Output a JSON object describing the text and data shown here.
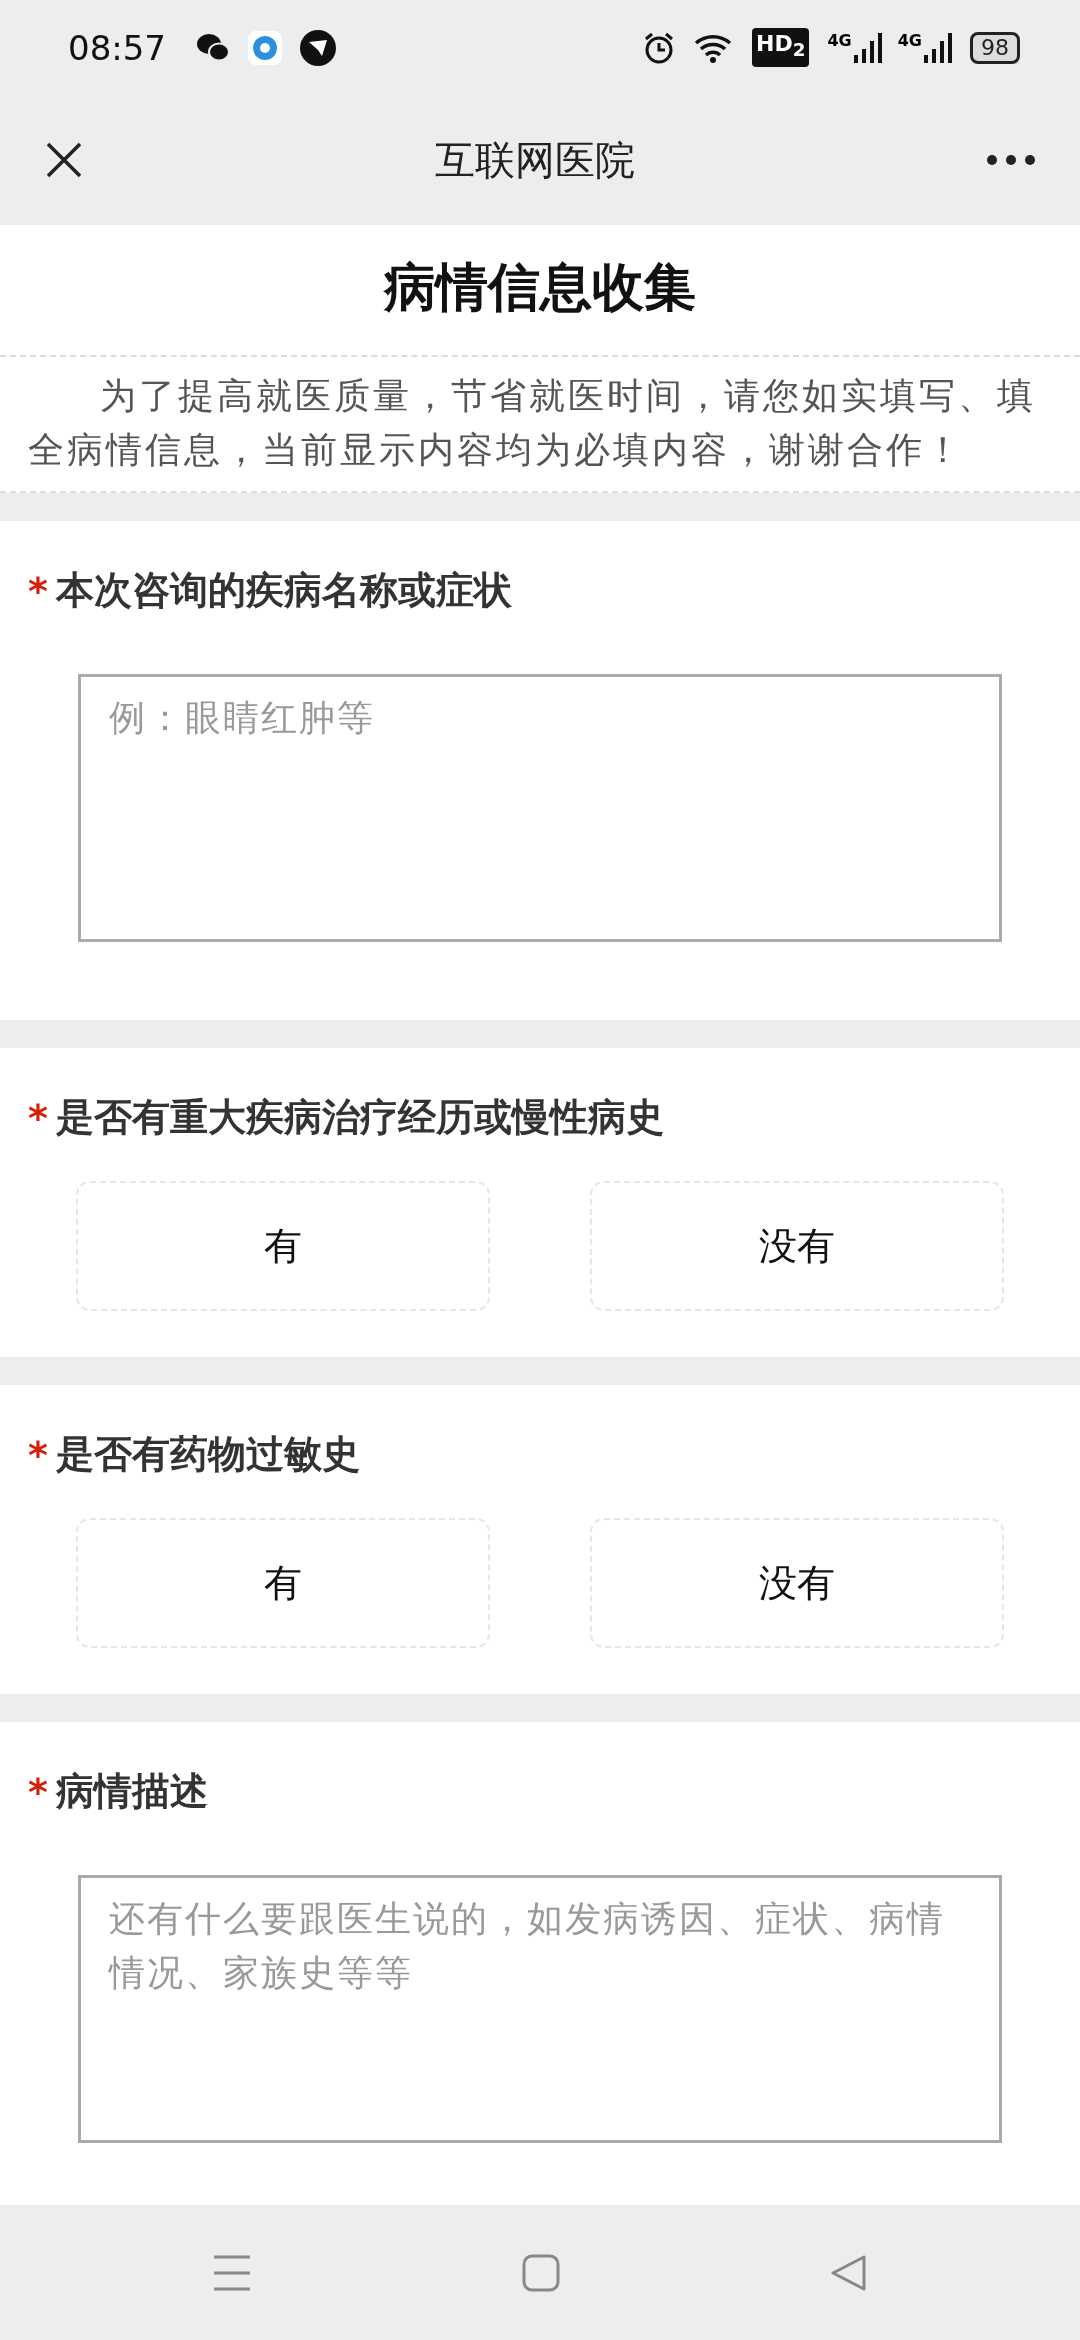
{
  "status_bar": {
    "time": "08:57",
    "hd_badge": "HD$_{2}$",
    "networks": [
      "4G",
      "4G"
    ],
    "battery": "98"
  },
  "nav_bar": {
    "title": "互联网医院"
  },
  "form": {
    "title": "病情信息收集",
    "intro": "为了提高就医质量，节省就医时间，请您如实填写、填全病情信息，当前显示内容均为必填内容，谢谢合作！",
    "questions": [
      {
        "kind": "text",
        "required_mark": "*",
        "label": "本次咨询的疾病名称或症状",
        "placeholder": "例：眼睛红肿等"
      },
      {
        "kind": "choice",
        "required_mark": "*",
        "label": "是否有重大疾病治疗经历或慢性病史",
        "options": [
          {
            "label": "有",
            "selected": false
          },
          {
            "label": "没有",
            "selected": false
          }
        ]
      },
      {
        "kind": "choice",
        "required_mark": "*",
        "label": "是否有药物过敏史",
        "options": [
          {
            "label": "有",
            "selected": false
          },
          {
            "label": "没有",
            "selected": false
          }
        ]
      },
      {
        "kind": "text",
        "required_mark": "*",
        "label": "病情描述",
        "placeholder": "还有什么要跟医生说的，如发病诱因、症状、病情情况、家族史等等"
      }
    ]
  }
}
